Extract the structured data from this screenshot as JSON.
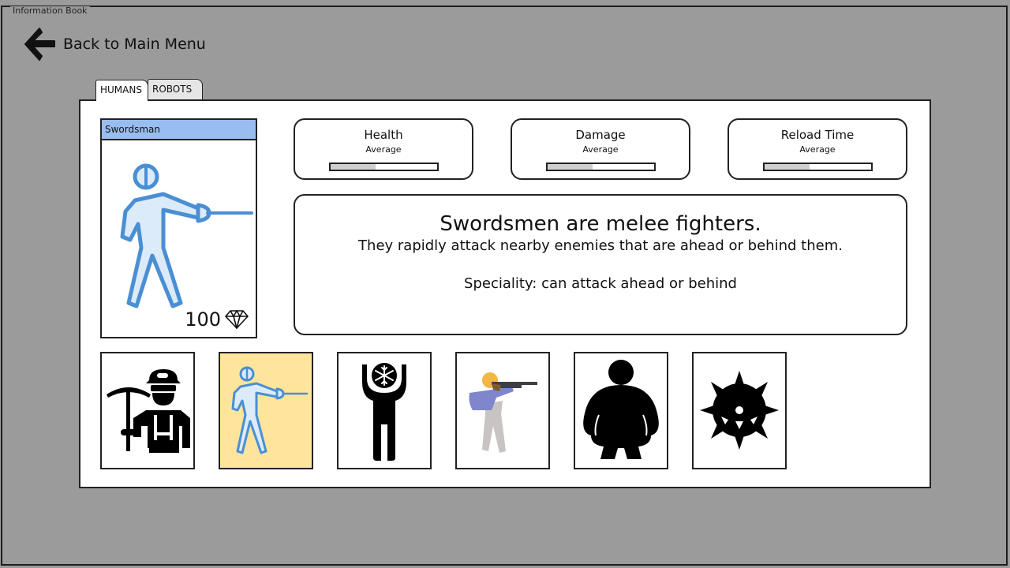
{
  "window": {
    "title": "Information Book"
  },
  "nav": {
    "back_label": "Back to Main Menu"
  },
  "tabs": [
    {
      "label": "HUMANS",
      "active": true
    },
    {
      "label": "ROBOTS",
      "active": false
    }
  ],
  "selected_unit": {
    "name": "Swordsman",
    "price": "100",
    "icon": "fencer-icon",
    "currency_icon": "diamond-icon"
  },
  "stats": [
    {
      "title": "Health",
      "level": "Average",
      "fill": 0.42
    },
    {
      "title": "Damage",
      "level": "Average",
      "fill": 0.42
    },
    {
      "title": "Reload Time",
      "level": "Average",
      "fill": 0.42
    }
  ],
  "description": {
    "headline": "Swordsmen are melee fighters.",
    "body": "They rapidly attack nearby enemies that are ahead or behind them.",
    "speciality": "Speciality: can attack ahead or behind"
  },
  "units": [
    {
      "icon": "miner-icon",
      "selected": false
    },
    {
      "icon": "fencer-icon",
      "selected": true
    },
    {
      "icon": "freezer-icon",
      "selected": false
    },
    {
      "icon": "rifleman-icon",
      "selected": false
    },
    {
      "icon": "heavy-person-icon",
      "selected": false
    },
    {
      "icon": "spiked-mine-icon",
      "selected": false
    }
  ],
  "colors": {
    "background": "#9b9b9b",
    "card_header": "#99bdf0",
    "selected_unit": "#ffe59c",
    "fencer_fill": "#dcebf9",
    "fencer_stroke": "#4a8fd4"
  }
}
